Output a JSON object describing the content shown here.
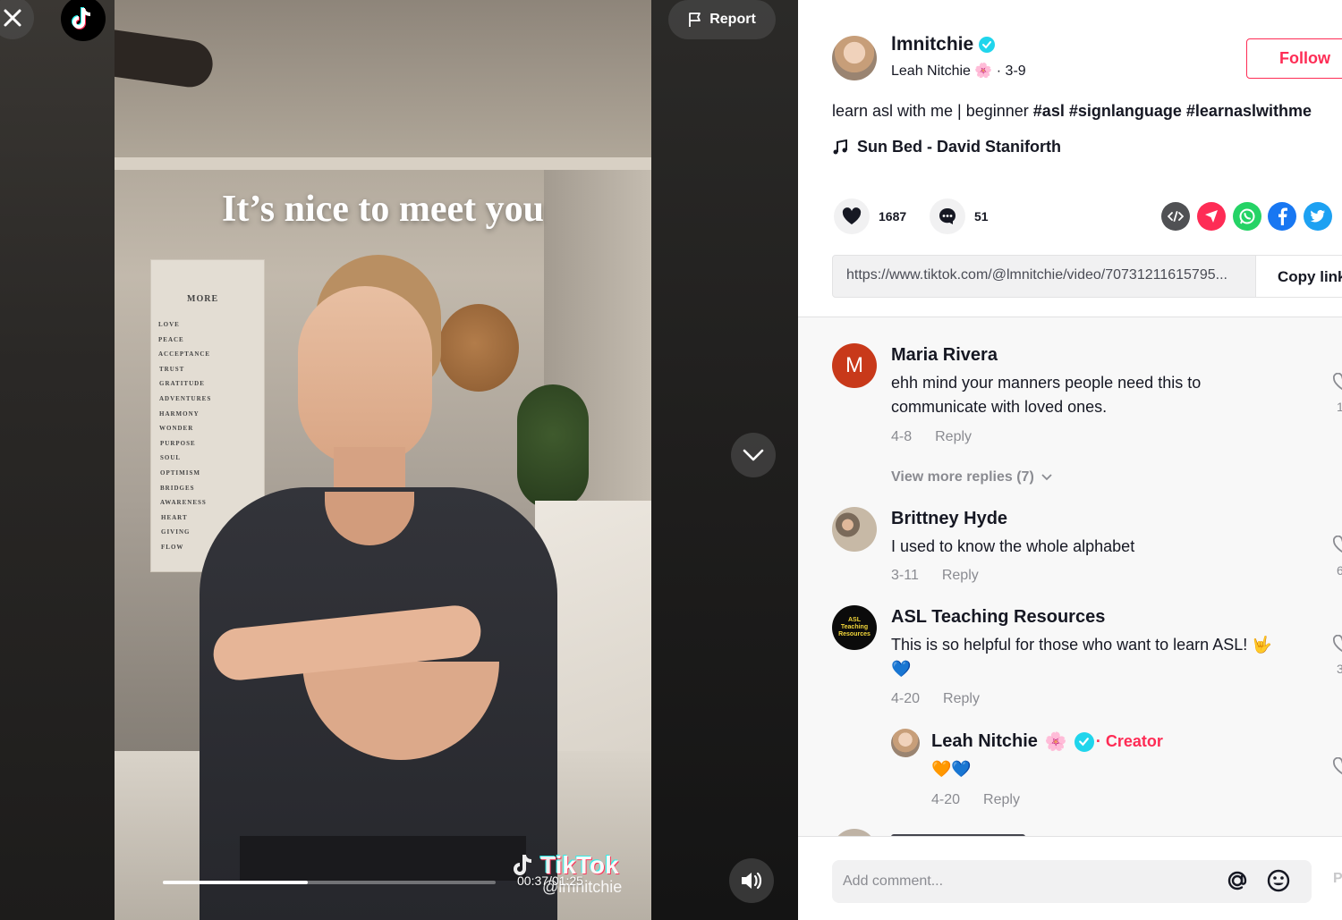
{
  "video": {
    "overlay_caption": "It’s nice to meet you",
    "poster_title": "MORE",
    "poster_words": [
      "LOVE",
      "PEACE",
      "ACCEPTANCE",
      "TRUST",
      "GRATITUDE",
      "ADVENTURES",
      "HARMONY",
      "WONDER",
      "PURPOSE",
      "SOUL",
      "OPTIMISM",
      "BRIDGES",
      "AWARENESS",
      "HEART",
      "GIVING",
      "FLOW"
    ],
    "report_label": "Report",
    "time": "00:37/01:25",
    "progress_fraction": 0.435,
    "watermark_brand": "TikTok",
    "watermark_user": "@lmnitchie"
  },
  "author": {
    "username": "lmnitchie",
    "display_name": "Leah Nitchie",
    "display_emoji": "🌸",
    "date": " · 3-9",
    "follow_label": "Follow"
  },
  "post": {
    "caption_text": "learn asl with me | beginner ",
    "hashtags": [
      "#asl",
      "#signlanguage",
      "#learnaslwithme"
    ],
    "music": "Sun Bed - David Staniforth",
    "likes": "1687",
    "comments_count": "51",
    "link": "https://www.tiktok.com/@lmnitchie/video/70731211615795...",
    "copy_label": "Copy link"
  },
  "share_icons": [
    "embed-icon",
    "send-to-friends-icon",
    "whatsapp-icon",
    "facebook-icon",
    "twitter-icon"
  ],
  "colors": {
    "accent": "#fe2c55",
    "verified": "#20d5ec"
  },
  "comments": [
    {
      "avatar_letter": "M",
      "name": "Maria Rivera",
      "text": "ehh mind your manners people need this to communicate with loved ones.",
      "date": "4-8",
      "reply": "Reply",
      "side_count": "1",
      "more_replies": "View more replies (7)"
    },
    {
      "name": "Brittney Hyde",
      "text": "I used to know the whole alphabet",
      "date": "3-11",
      "reply": "Reply",
      "side_count": "6"
    },
    {
      "name": "ASL Teaching Resources",
      "avatar_text": "ASL Teaching Resources",
      "text": "This is so helpful for those who want to learn ASL! 🤟",
      "text_line2": "💙",
      "date": "4-20",
      "reply": "Reply",
      "side_count": "3"
    },
    {
      "name": "Leah Nitchie",
      "emoji": "🌸",
      "creator_label": "· Creator",
      "text": "🧡💙",
      "date": "4-20",
      "reply": "Reply"
    }
  ],
  "composer": {
    "placeholder": "Add comment...",
    "post_label": "P"
  }
}
